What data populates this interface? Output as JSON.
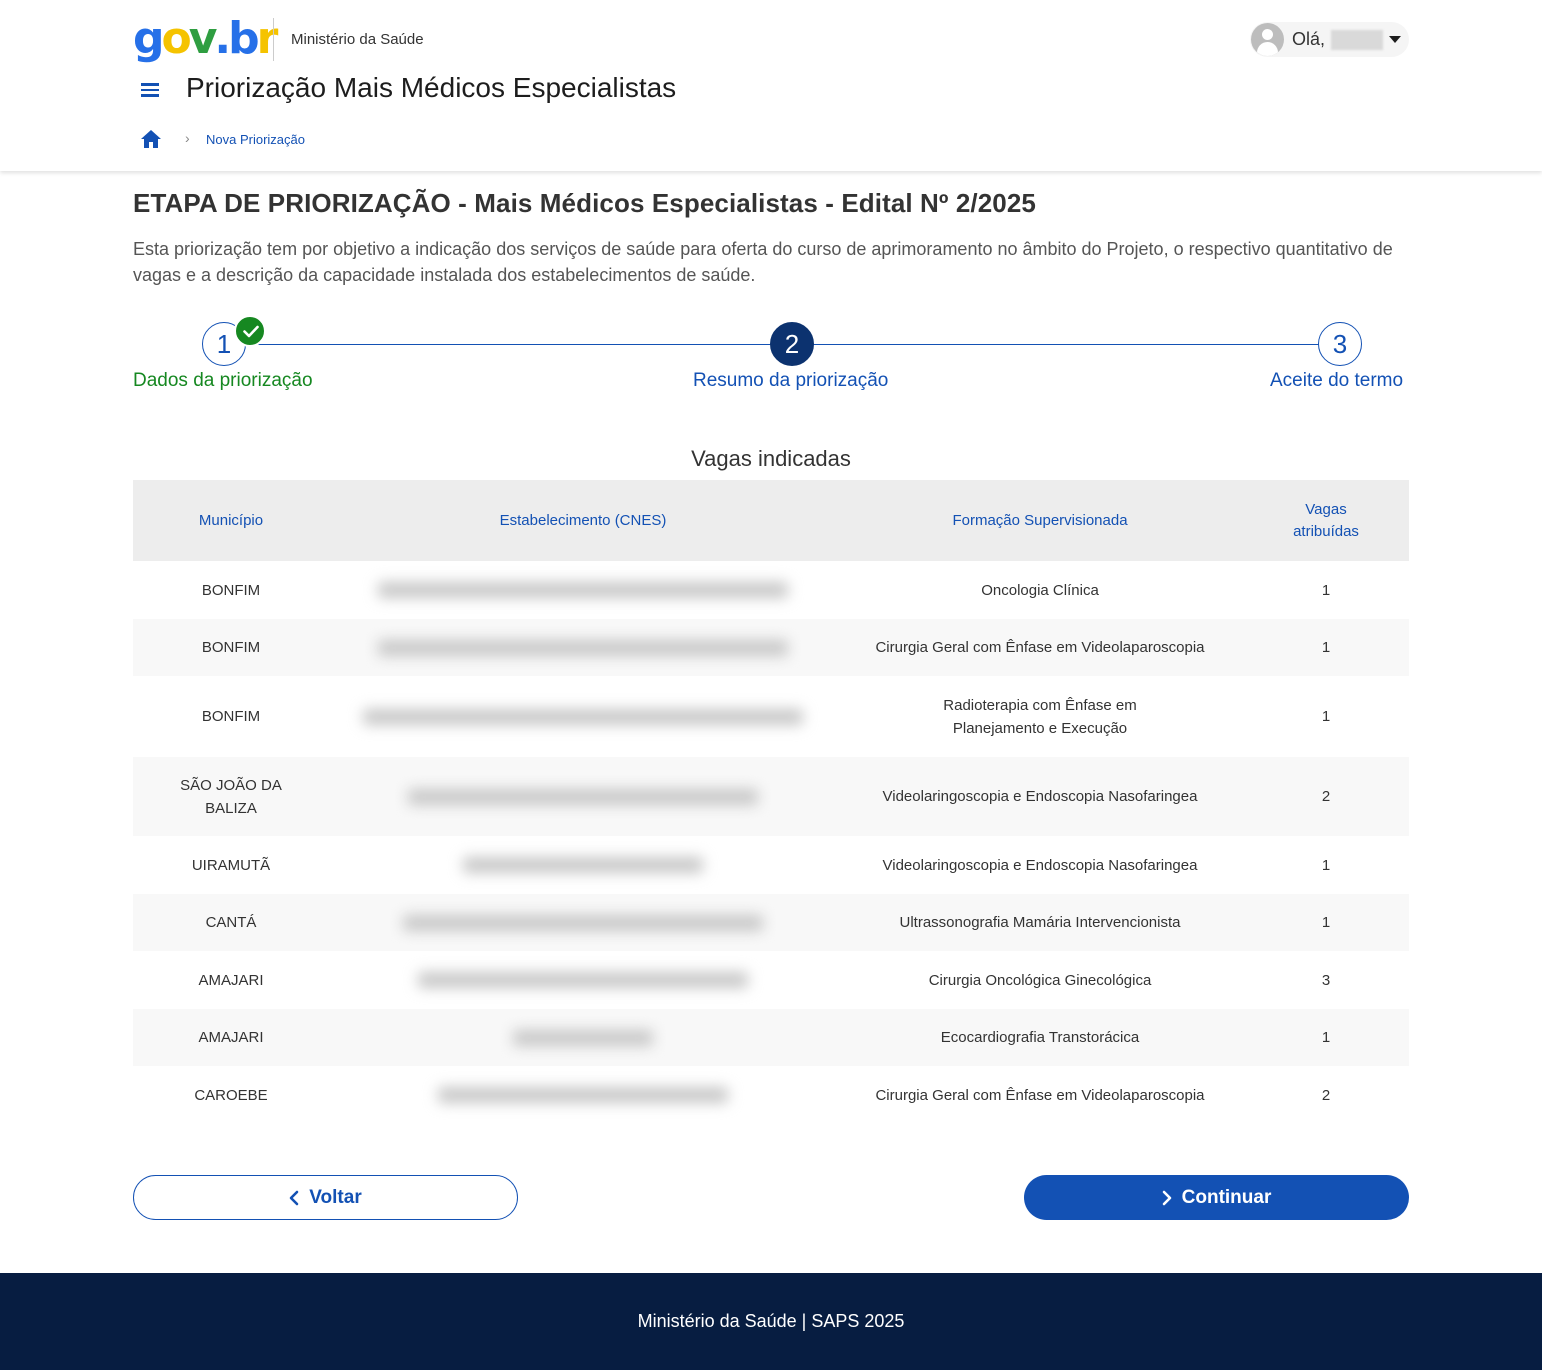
{
  "header": {
    "logo": {
      "g": "g",
      "o": "o",
      "v": "v",
      "dot": ".",
      "b": "b",
      "r": "r"
    },
    "ministry": "Ministério da Saúde",
    "greeting": "Olá,",
    "app_title": "Priorização Mais Médicos Especialistas",
    "breadcrumb": {
      "current": "Nova Priorização"
    }
  },
  "main": {
    "title": "ETAPA DE PRIORIZAÇÃO - Mais Médicos Especialistas - Edital Nº 2/2025",
    "description": "Esta priorização tem por objetivo a indicação dos serviços de saúde para oferta do curso de aprimoramento no âmbito do Projeto, o respectivo quantitativo de vagas e a descrição da capacidade instalada dos estabelecimentos de saúde."
  },
  "stepper": {
    "steps": [
      {
        "number": "1",
        "label": "Dados da priorização",
        "status": "done"
      },
      {
        "number": "2",
        "label": "Resumo da priorização",
        "status": "active"
      },
      {
        "number": "3",
        "label": "Aceite do termo",
        "status": "pending"
      }
    ]
  },
  "table": {
    "caption": "Vagas indicadas",
    "headers": {
      "municipio": "Município",
      "estabelecimento": "Estabelecimento (CNES)",
      "formacao": "Formação Supervisionada",
      "vagas": "Vagas atribuídas"
    },
    "rows": [
      {
        "municipio": "BONFIM",
        "formacao": "Oncologia Clínica",
        "vagas": "1"
      },
      {
        "municipio": "BONFIM",
        "formacao": "Cirurgia Geral com Ênfase em Videolaparoscopia",
        "vagas": "1"
      },
      {
        "municipio": "BONFIM",
        "formacao": "Radioterapia com Ênfase em Planejamento e Execução",
        "vagas": "1"
      },
      {
        "municipio": "SÃO JOÃO DA BALIZA",
        "formacao": "Videolaringoscopia e Endoscopia Nasofaringea",
        "vagas": "2"
      },
      {
        "municipio": "UIRAMUTÃ",
        "formacao": "Videolaringoscopia e Endoscopia Nasofaringea",
        "vagas": "1"
      },
      {
        "municipio": "CANTÁ",
        "formacao": "Ultrassonografia Mamária Intervencionista",
        "vagas": "1"
      },
      {
        "municipio": "AMAJARI",
        "formacao": "Cirurgia Oncológica Ginecológica",
        "vagas": "3"
      },
      {
        "municipio": "AMAJARI",
        "formacao": "Ecocardiografia Transtorácica",
        "vagas": "1"
      },
      {
        "municipio": "CAROEBE",
        "formacao": "Cirurgia Geral com Ênfase em Videolaparoscopia",
        "vagas": "2"
      }
    ]
  },
  "buttons": {
    "back": "Voltar",
    "next": "Continuar"
  },
  "footer": {
    "text": "Ministério da Saúde | SAPS 2025"
  },
  "colors": {
    "primary": "#1351b4",
    "active_step": "#0c326f",
    "success": "#168821",
    "footer_bg": "#071d41"
  },
  "icons": {
    "menu": "menu-icon",
    "home": "home-icon",
    "check": "check-icon",
    "chevron_left": "chevron-left-icon",
    "chevron_right": "chevron-right-icon",
    "caret": "caret-down-icon",
    "avatar": "user-avatar-icon"
  }
}
